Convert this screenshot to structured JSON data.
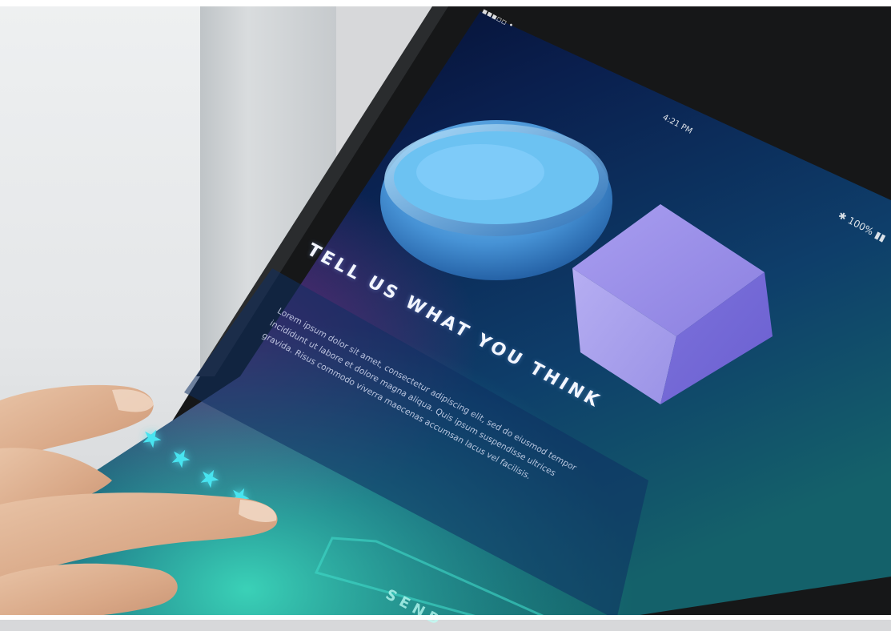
{
  "screen": {
    "title": "TELL US WHAT YOU THINK",
    "body": "Lorem ipsum dolor sit amet, consectetur adipiscing elit, sed do eiusmod tempor incididunt ut labore et dolore magna aliqua. Quis ipsum suspendisse ultrices gravida. Risus commodo viverra maecenas accumsan lacus vel facilisis.",
    "send_label": "SEND"
  },
  "status_bar": {
    "carrier": "▪▪▪▫▫  •",
    "time": "4:21 PM",
    "battery": "100%"
  },
  "rating": {
    "value": 4,
    "max": 5
  },
  "colors": {
    "screen_dark": "#050a2a",
    "screen_blue": "#0b2a5c",
    "screen_teal": "#1a6f78",
    "star": "#48e4f0",
    "cube": "#8f86e6",
    "bowl": "#5fb3e6"
  },
  "icons": [
    "bluetooth-icon",
    "battery-icon",
    "star-icon"
  ]
}
